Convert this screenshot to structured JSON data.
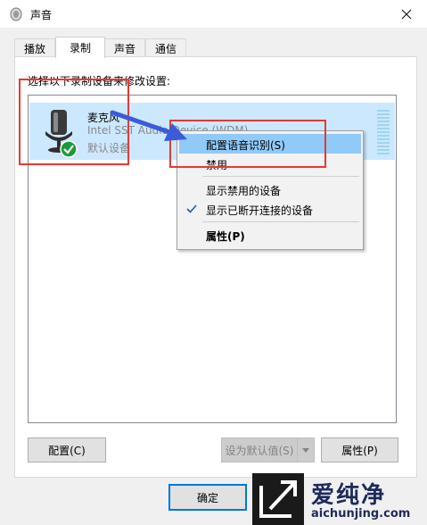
{
  "window": {
    "title": "声音"
  },
  "tabs": [
    {
      "label": "播放",
      "active": false
    },
    {
      "label": "录制",
      "active": true
    },
    {
      "label": "声音",
      "active": false
    },
    {
      "label": "通信",
      "active": false
    }
  ],
  "instruction": "选择以下录制设备来修改设置:",
  "device": {
    "name": "麦克风",
    "description": "Intel SST Audio Device (WDM)",
    "status": "默认设备",
    "icon": "microphone-icon",
    "badge": "green-check-icon"
  },
  "context_menu": {
    "items": [
      {
        "label": "配置语音识别(S)",
        "highlighted": true
      },
      {
        "label": "禁用"
      },
      {
        "label": "显示禁用的设备"
      },
      {
        "label": "显示已断开连接的设备",
        "checked": true
      },
      {
        "label": "属性(P)",
        "bold": true
      }
    ]
  },
  "buttons": {
    "configure": "配置(C)",
    "set_default": "设为默认值(S)",
    "properties": "属性(P)",
    "ok": "确定"
  },
  "watermark": {
    "title": "爱纯净",
    "url": "aichunjing.com"
  },
  "colors": {
    "selection": "#cce8ff",
    "menu_highlight": "#91c9f7",
    "annotation": "#e53935",
    "arrow": "#3b5bdb",
    "check": "#1a9a3a"
  }
}
